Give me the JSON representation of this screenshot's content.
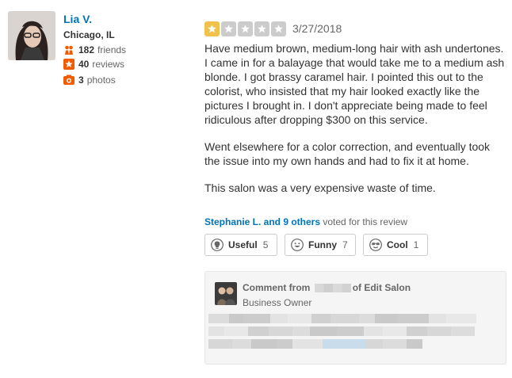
{
  "user": {
    "name": "Lia V.",
    "location": "Chicago, IL",
    "friends_count": "182",
    "friends_label": "friends",
    "reviews_count": "40",
    "reviews_label": "reviews",
    "photos_count": "3",
    "photos_label": "photos"
  },
  "review": {
    "rating": 1,
    "max_rating": 5,
    "date": "3/27/2018",
    "paragraphs": [
      "Have medium brown, medium-long hair with ash undertones. I came in for a balayage that would take me to a medium ash blonde. I got brassy caramel hair. I pointed this out to the colorist, who insisted that my hair looked exactly like the pictures I brought in. I don't appreciate being made to feel ridiculous after dropping $300 on this service.",
      "Went elsewhere for a color correction, and eventually took the issue into my own hands and had to fix it at home.",
      "This salon was a very expensive waste of time."
    ],
    "voters_link": "Stephanie L. and 9 others",
    "voters_suffix": "voted for this review"
  },
  "vote_buttons": {
    "useful_label": "Useful",
    "useful_count": "5",
    "funny_label": "Funny",
    "funny_count": "7",
    "cool_label": "Cool",
    "cool_count": "1"
  },
  "owner_comment": {
    "title_prefix": "Comment from",
    "title_suffix": "of Edit Salon",
    "role": "Business Owner"
  },
  "colors": {
    "link": "#0073bb",
    "star_on": "#f0c14b",
    "star_off": "#cccccc",
    "stat_icon": "#f15c00"
  },
  "icons": {
    "friends": "friends-icon",
    "reviews": "star-badge-icon",
    "photos": "camera-icon",
    "useful": "lightbulb-icon",
    "funny": "smiley-icon",
    "cool": "sunglasses-icon"
  }
}
